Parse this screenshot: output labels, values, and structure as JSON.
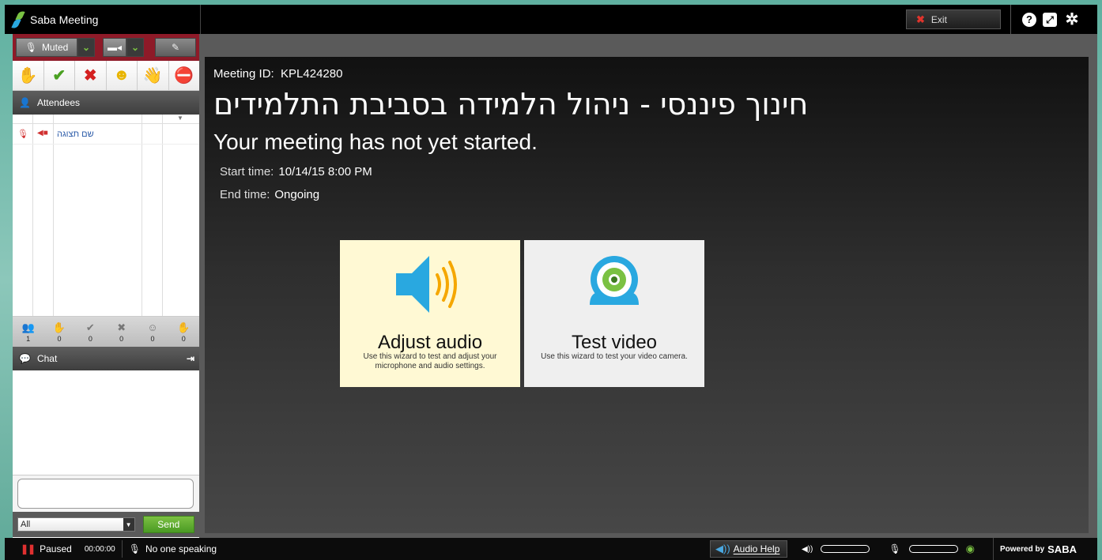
{
  "app": {
    "title": "Saba Meeting"
  },
  "toolbar": {
    "exit_label": "Exit"
  },
  "av": {
    "mic_label": "Muted"
  },
  "attendees": {
    "header": "Attendees",
    "rows": [
      {
        "name": "שם תצוגה"
      }
    ],
    "counts": [
      "1",
      "0",
      "0",
      "0",
      "0",
      "0"
    ]
  },
  "chat": {
    "header": "Chat",
    "recipient": "All",
    "send_label": "Send"
  },
  "meeting": {
    "id_label": "Meeting ID:",
    "id_value": "KPL424280",
    "title": "חינוך פיננסי - ניהול הלמידה בסביבת התלמידים",
    "status": "Your meeting has not yet started.",
    "start_label": "Start time:",
    "start_value": "10/14/15 8:00 PM",
    "end_label": "End time:",
    "end_value": "Ongoing"
  },
  "wizards": {
    "audio": {
      "title": "Adjust audio",
      "desc": "Use this wizard to test and adjust your microphone and audio settings."
    },
    "video": {
      "title": "Test video",
      "desc": "Use this wizard to test your video camera."
    }
  },
  "statusbar": {
    "paused_label": "Paused",
    "timer": "00:00:00",
    "speaking": "No one speaking",
    "audio_help": "Audio Help",
    "powered_by": "Powered by",
    "brand": "SABA"
  },
  "colors": {
    "accent_green": "#7ac142",
    "accent_blue": "#29a8e0",
    "mute_red": "#8e1a28"
  }
}
